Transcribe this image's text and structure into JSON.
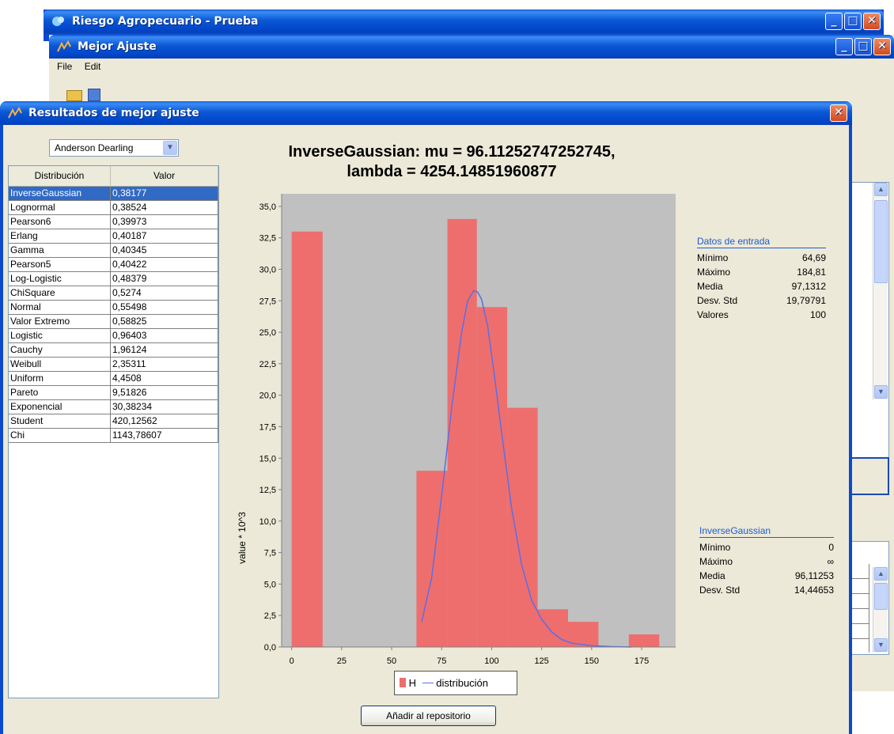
{
  "back_window": {
    "title": "Riesgo Agropecuario - Prueba"
  },
  "mid_window": {
    "title": "Mejor Ajuste",
    "menu": [
      "File",
      "Edit"
    ]
  },
  "dialog": {
    "title": "Resultados de mejor ajuste",
    "test_selector": {
      "value": "Anderson Dearling"
    },
    "table": {
      "headers": [
        "Distribución",
        "Valor"
      ],
      "selected_index": 0,
      "rows": [
        [
          "InverseGaussian",
          "0,38177"
        ],
        [
          "Lognormal",
          "0,38524"
        ],
        [
          "Pearson6",
          "0,39973"
        ],
        [
          "Erlang",
          "0,40187"
        ],
        [
          "Gamma",
          "0,40345"
        ],
        [
          "Pearson5",
          "0,40422"
        ],
        [
          "Log-Logistic",
          "0,48379"
        ],
        [
          "ChiSquare",
          "0,5274"
        ],
        [
          "Normal",
          "0,55498"
        ],
        [
          "Valor Extremo",
          "0,58825"
        ],
        [
          "Logistic",
          "0,96403"
        ],
        [
          "Cauchy",
          "1,96124"
        ],
        [
          "Weibull",
          "2,35311"
        ],
        [
          "Uniform",
          "4,4508"
        ],
        [
          "Pareto",
          "9,51826"
        ],
        [
          "Exponencial",
          "30,38234"
        ],
        [
          "Student",
          "420,12562"
        ],
        [
          "Chi",
          "1143,78607"
        ]
      ]
    },
    "input_stats": {
      "title": "Datos de entrada",
      "rows": [
        [
          "Mínimo",
          "64,69"
        ],
        [
          "Máximo",
          "184,81"
        ],
        [
          "Media",
          "97,1312"
        ],
        [
          "Desv. Std",
          "19,79791"
        ],
        [
          "Valores",
          "100"
        ]
      ]
    },
    "dist_stats": {
      "title": "InverseGaussian",
      "rows": [
        [
          "Mínimo",
          "0"
        ],
        [
          "Máximo",
          "∞"
        ],
        [
          "Media",
          "96,11253"
        ],
        [
          "Desv. Std",
          "14,44653"
        ]
      ]
    },
    "add_button": "Añadir al repositorio",
    "colors": {
      "bars": "#ee6e6e",
      "curve": "#5a6ee8",
      "plot_bg": "#c0c0c0",
      "selection": "#316ac5"
    }
  },
  "chart_data": {
    "type": "bar",
    "title_line1": "InverseGaussian: mu = 96.11252747252745,",
    "title_line2": "lambda = 4254.14851960877",
    "ylabel": "value * 10^3",
    "xlabel": "",
    "xlim": [
      -5,
      192
    ],
    "ylim": [
      0,
      36
    ],
    "x_ticks": [
      "0",
      "25",
      "50",
      "75",
      "100",
      "125",
      "150",
      "175"
    ],
    "y_ticks": [
      "0,0",
      "2,5",
      "5,0",
      "7,5",
      "10,0",
      "12,5",
      "15,0",
      "17,5",
      "20,0",
      "22,5",
      "25,0",
      "27,5",
      "30,0",
      "32,5",
      "35,0"
    ],
    "bins": [
      {
        "x0": 0,
        "x1": 15.5,
        "value": 33
      },
      {
        "x0": 62.4,
        "x1": 77.9,
        "value": 14
      },
      {
        "x0": 77.9,
        "x1": 92.6,
        "value": 34
      },
      {
        "x0": 92.6,
        "x1": 107.8,
        "value": 27
      },
      {
        "x0": 107.8,
        "x1": 123,
        "value": 19
      },
      {
        "x0": 123,
        "x1": 138.2,
        "value": 3
      },
      {
        "x0": 138.2,
        "x1": 153.4,
        "value": 2
      },
      {
        "x0": 168.6,
        "x1": 183.8,
        "value": 1
      }
    ],
    "series": [
      {
        "name": "distribución",
        "x": [
          65,
          70,
          75,
          80,
          85,
          88,
          91,
          93,
          95,
          98,
          101,
          105,
          110,
          115,
          120,
          125,
          130,
          135,
          140,
          150,
          160,
          170
        ],
        "y": [
          2,
          5.5,
          12,
          19,
          25,
          27.5,
          28.3,
          28.2,
          27.6,
          25.5,
          22,
          17,
          11,
          6.5,
          3.7,
          2.2,
          1.2,
          0.6,
          0.3,
          0.1,
          0.03,
          0
        ]
      }
    ],
    "legend": [
      "H",
      "distribución"
    ]
  }
}
